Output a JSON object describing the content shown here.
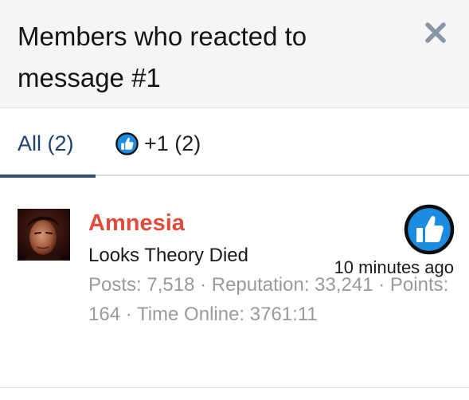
{
  "dialog": {
    "title": "Members who reacted to message #1",
    "close_icon": "close-icon"
  },
  "tabs": [
    {
      "label": "All (2)",
      "active": true
    },
    {
      "label": "+1 (2)",
      "icon": "thumbs-up-icon",
      "active": false
    }
  ],
  "members": [
    {
      "name": "Amnesia",
      "name_color": "#e24a3a",
      "title": "Looks Theory Died",
      "stats": "Posts: 7,518 · Reputation: 33,241 · Points: 164 · Time Online: 3761:11",
      "reaction_icon": "thumbs-up-icon",
      "time": "10 minutes ago"
    }
  ],
  "colors": {
    "accent": "#2b4b83",
    "reaction_blue": "#1d8ce0",
    "username": "#e24a3a",
    "header_bg": "#f5f5f5"
  }
}
